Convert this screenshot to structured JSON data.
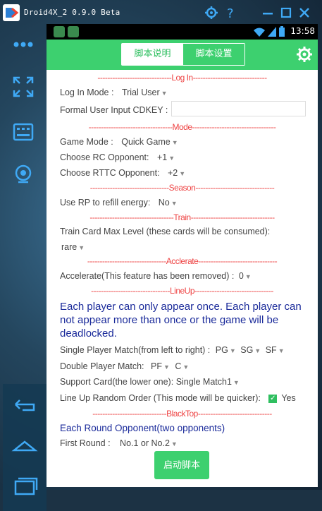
{
  "window": {
    "title": "Droid4X_2 0.9.0 Beta"
  },
  "status_bar": {
    "time": "13:58"
  },
  "header": {
    "tabs": [
      {
        "label": "脚本说明"
      },
      {
        "label": "脚本设置"
      }
    ]
  },
  "sections": {
    "login": "Log In",
    "mode": "Mode",
    "season": "Season",
    "train": "Train",
    "accelerate": "Acclerate",
    "lineup": "LineUp",
    "blacktop": "BlackTop"
  },
  "fields": {
    "login_mode": {
      "label": "Log In Mode :",
      "value": "Trial User"
    },
    "cdkey": {
      "label": "Formal User Input CDKEY :",
      "value": ""
    },
    "game_mode": {
      "label": "Game Mode :",
      "value": "Quick Game"
    },
    "rc_opponent": {
      "label": "Choose RC  Opponent:",
      "value": "+1"
    },
    "rttc_opponent": {
      "label": "Choose RTTC  Opponent:",
      "value": "+2"
    },
    "refill_energy": {
      "label": "Use RP to refill energy:",
      "value": "No"
    },
    "train_card": {
      "label": "Train Card Max Level (these cards will be consumed):",
      "value": "rare"
    },
    "accelerate": {
      "label": "Accelerate(This feature has been removed) :",
      "value": "0"
    },
    "single_match": {
      "label": "Single Player Match(from left to right) :",
      "values": [
        "PG",
        "SG",
        "SF"
      ]
    },
    "double_match": {
      "label": "Double Player Match:",
      "values": [
        "PF",
        "C"
      ]
    },
    "support_card": {
      "label": "Support Card(the lower one):",
      "value": "Single Match1"
    },
    "random_order": {
      "label": "Line Up Random Order (This mode will be quicker):",
      "value": "Yes",
      "checked": true
    },
    "first_round": {
      "label": "First Round :",
      "value": "No.1 or No.2"
    }
  },
  "lineup_notice": "Each player can only appear once. Each player can not appear more than once or the game will be deadlocked.",
  "blacktop_heading": "Each Round Opponent(two opponents)",
  "start_button": "启动脚本",
  "colors": {
    "accent": "#3dd06f",
    "separator": "#e44444",
    "notice": "#1a2a9a"
  }
}
